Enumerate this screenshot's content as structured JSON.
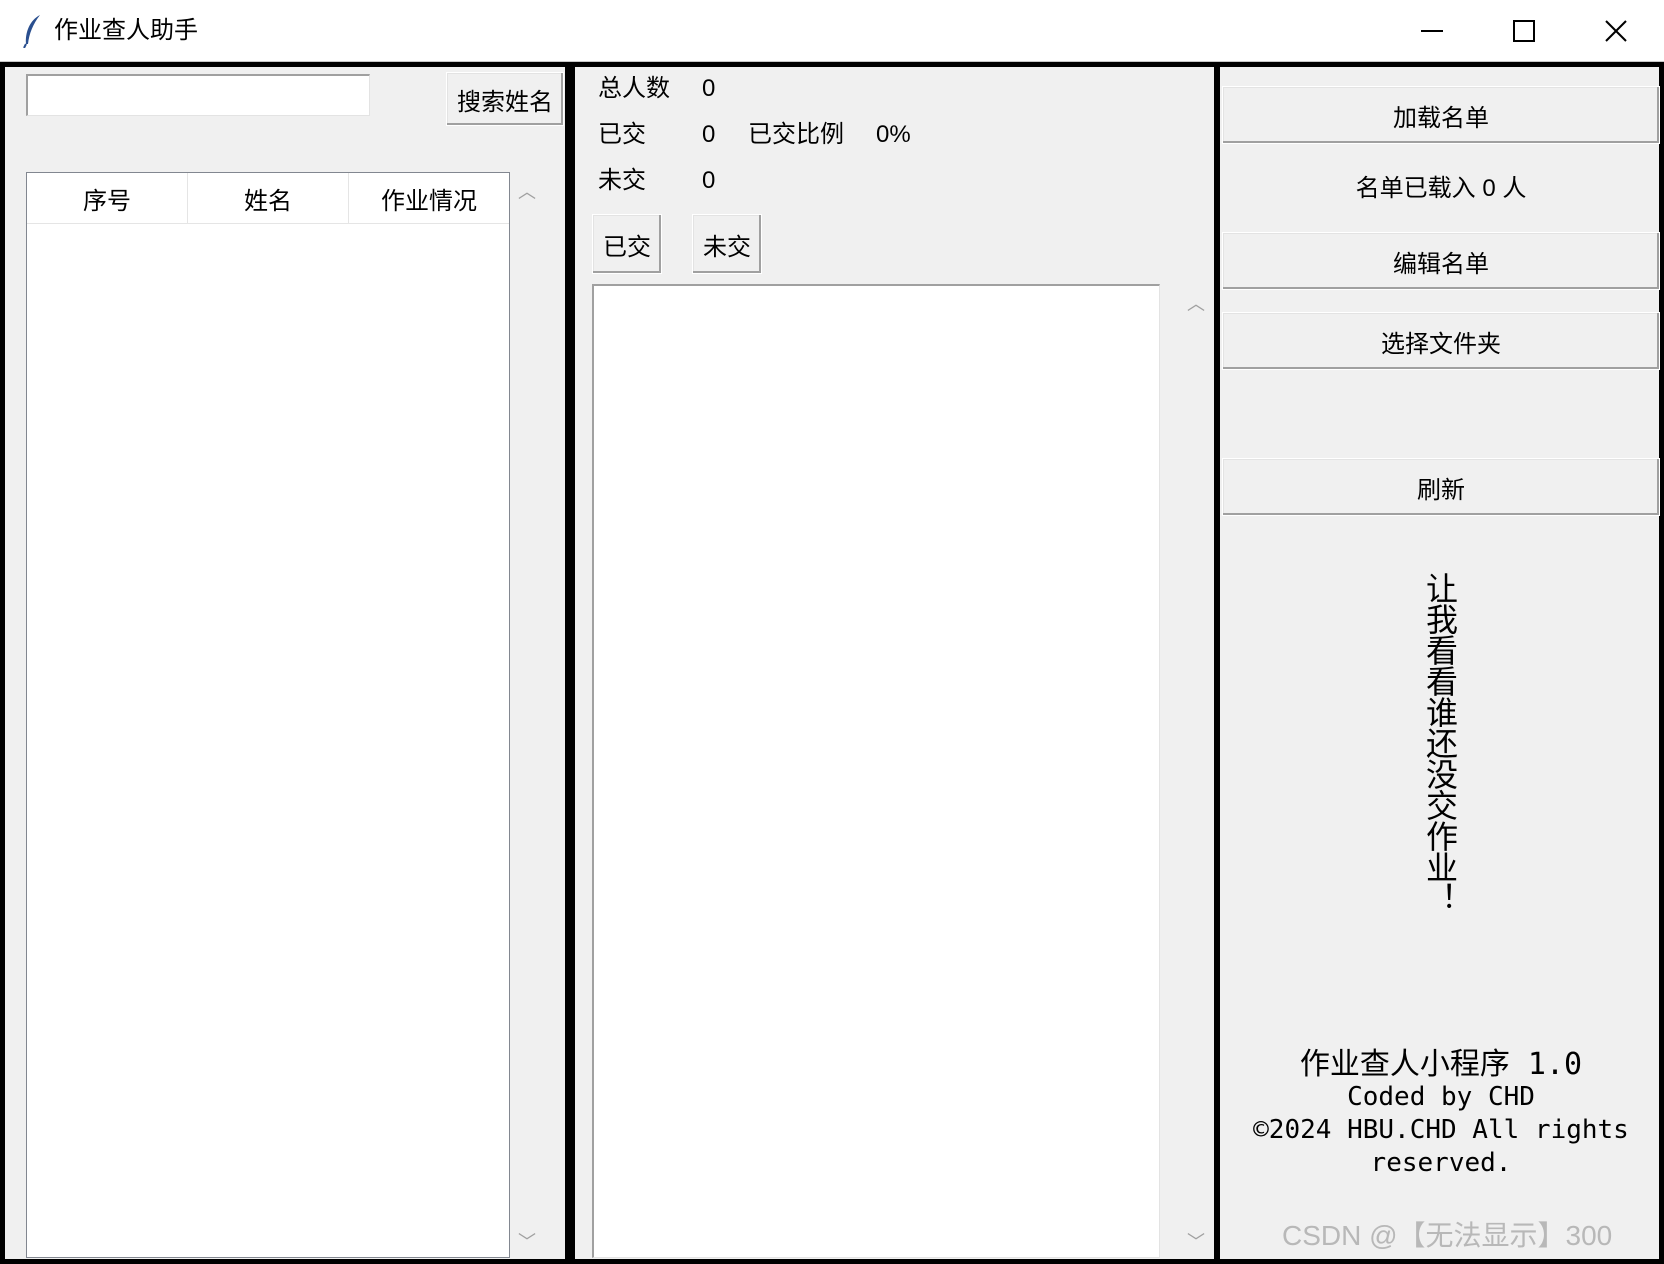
{
  "window": {
    "title": "作业查人助手",
    "minimize_glyph": "—",
    "maximize_glyph": "☐",
    "close_glyph": "✕"
  },
  "left": {
    "search_input_value": "",
    "search_button": "搜索姓名",
    "table_columns": [
      "序号",
      "姓名",
      "作业情况"
    ],
    "table_rows": []
  },
  "middle": {
    "total_label": "总人数",
    "total_value": "0",
    "submitted_label": "已交",
    "submitted_value": "0",
    "ratio_label": "已交比例",
    "ratio_value": "0%",
    "missing_label": "未交",
    "missing_value": "0",
    "btn_submitted": "已交",
    "btn_missing": "未交",
    "list_items": []
  },
  "right": {
    "load_list_button": "加载名单",
    "loaded_status": "名单已载入 0 人",
    "edit_list_button": "编辑名单",
    "choose_folder_button": "选择文件夹",
    "refresh_button": "刷新",
    "slogan": "让我看看谁还没交作业！",
    "credit_line1": "作业查人小程序 1.0",
    "credit_line2": "Coded by CHD",
    "credit_line3": "©2024 HBU.CHD All rights",
    "credit_line4": "reserved."
  },
  "watermark": "CSDN @【无法显示】300",
  "colors": {
    "background": "#f0f0f0",
    "border": "#000000",
    "field": "#ffffff"
  }
}
